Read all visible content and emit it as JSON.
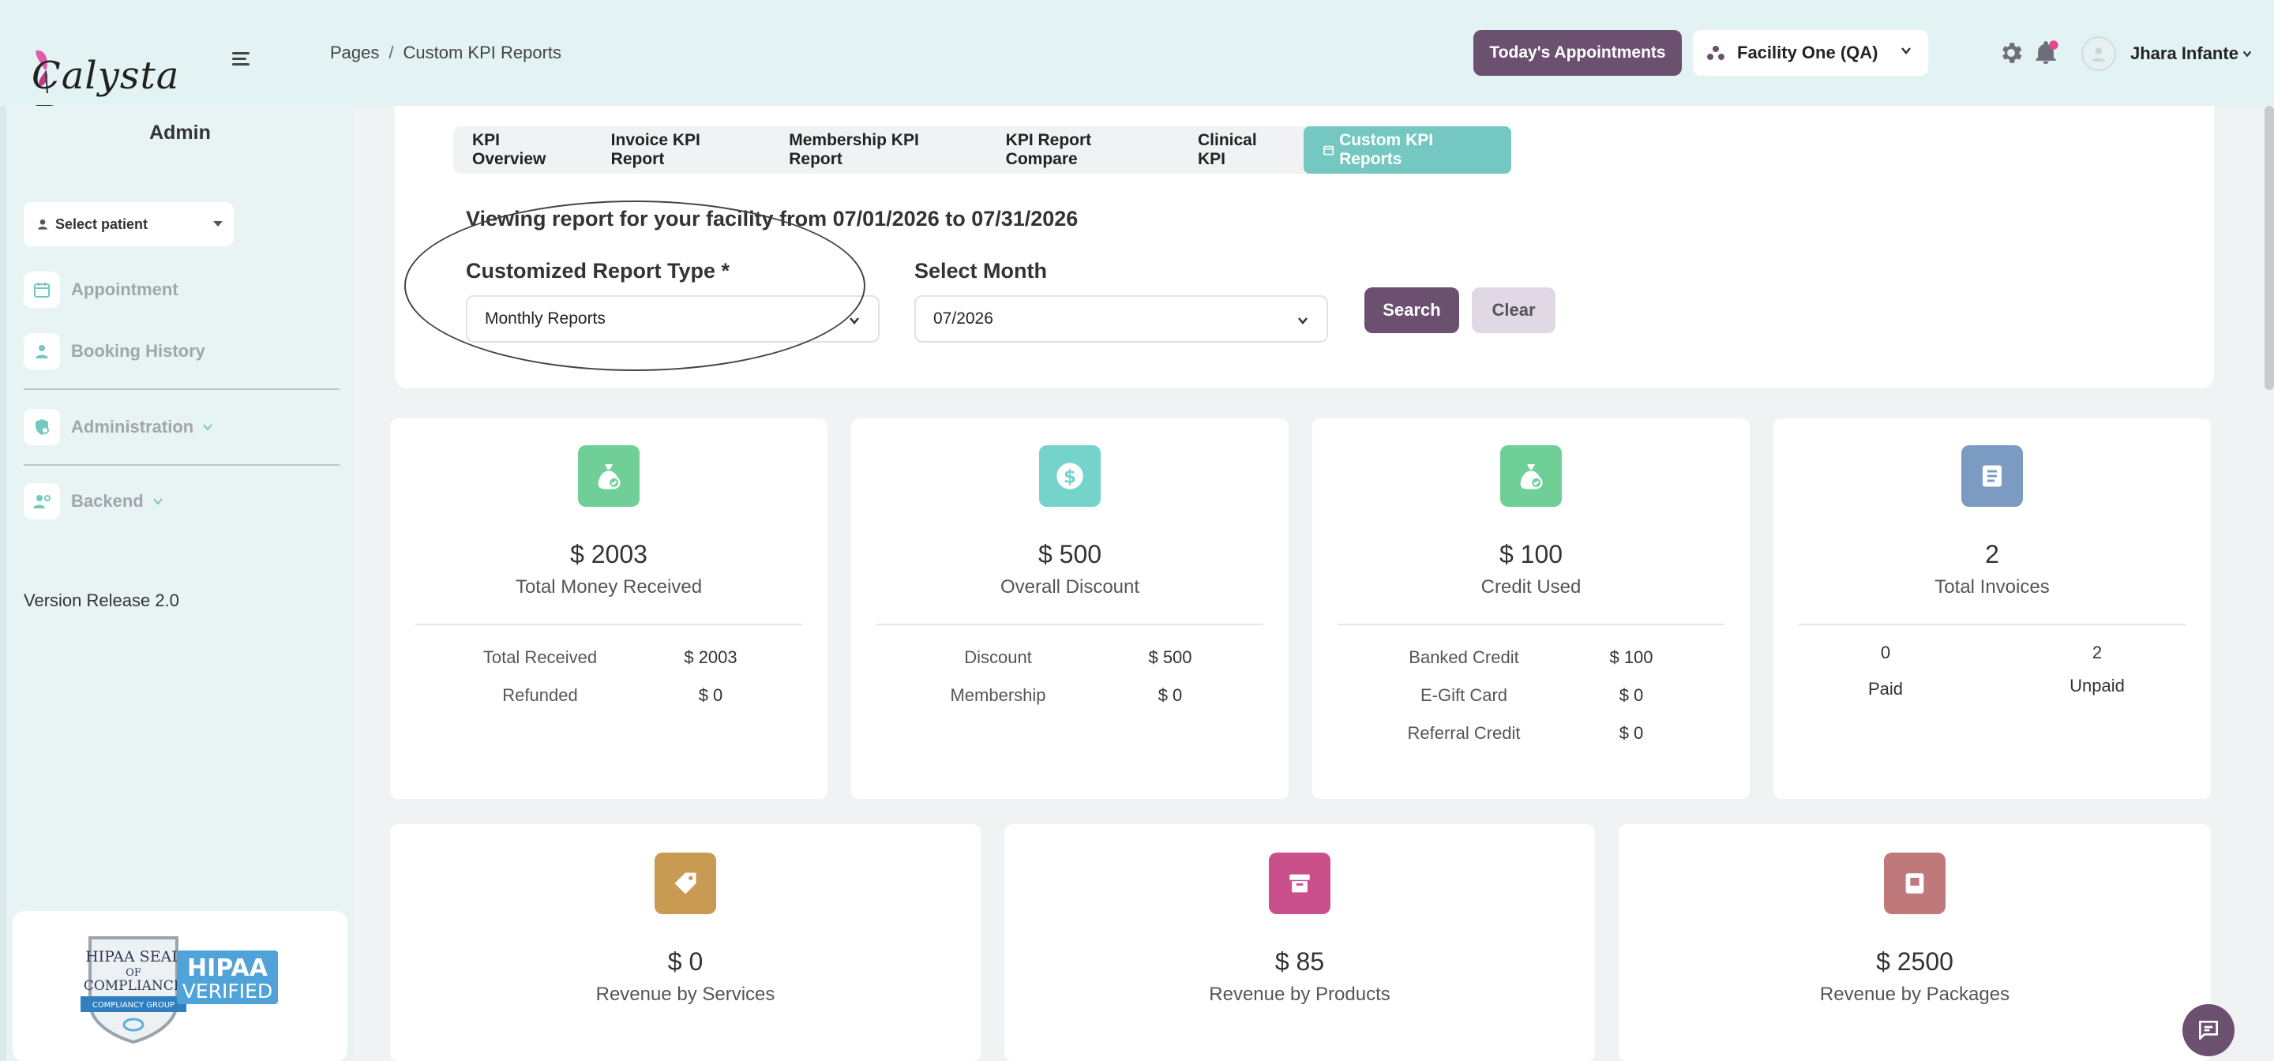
{
  "header": {
    "logo_text": "Calysta Pro",
    "breadcrumb": {
      "root": "Pages",
      "sep": "/",
      "current": "Custom KPI Reports"
    },
    "appointments_button": "Today's Appointments",
    "facility": "Facility One (QA)",
    "user_name": "Jhara Infante"
  },
  "sidebar": {
    "title": "Admin",
    "select_patient": "Select patient",
    "items": [
      {
        "label": "Appointment",
        "icon": "calendar-icon"
      },
      {
        "label": "Booking History",
        "icon": "person-icon"
      },
      {
        "label": "Administration",
        "icon": "shield-icon"
      },
      {
        "label": "Backend",
        "icon": "user-cog-icon"
      }
    ],
    "version": "Version Release 2.0",
    "hipaa": {
      "line1": "HIPAA SEAL",
      "line2": "OF",
      "line3": "COMPLIANCE",
      "ribbon": "COMPLIANCY GROUP",
      "badge_top": "HIPAA",
      "badge_bottom": "VERIFIED"
    }
  },
  "tabs": [
    {
      "label": "KPI Overview",
      "active": false
    },
    {
      "label": "Invoice KPI Report",
      "active": false
    },
    {
      "label": "Membership KPI Report",
      "active": false
    },
    {
      "label": "KPI Report Compare",
      "active": false
    },
    {
      "label": "Clinical KPI",
      "active": false
    },
    {
      "label": "Custom KPI Reports",
      "active": true
    }
  ],
  "filters": {
    "viewing_text": "Viewing report for your facility from 07/01/2026 to 07/31/2026",
    "report_type_label": "Customized Report Type *",
    "report_type_value": "Monthly Reports",
    "month_label": "Select Month",
    "month_value": "07/2026",
    "search_label": "Search",
    "clear_label": "Clear"
  },
  "kpi_cards": [
    {
      "value": "$ 2003",
      "label": "Total Money Received",
      "color": "#6fcf97",
      "rows": [
        {
          "label": "Total Received",
          "value": "$ 2003"
        },
        {
          "label": "Refunded",
          "value": "$ 0"
        }
      ]
    },
    {
      "value": "$ 500",
      "label": "Overall Discount",
      "color": "#74d4cc",
      "rows": [
        {
          "label": "Discount",
          "value": "$ 500"
        },
        {
          "label": "Membership",
          "value": "$ 0"
        }
      ]
    },
    {
      "value": "$ 100",
      "label": "Credit Used",
      "color": "#6fcf97",
      "rows": [
        {
          "label": "Banked Credit",
          "value": "$ 100"
        },
        {
          "label": "E-Gift Card",
          "value": "$ 0"
        },
        {
          "label": "Referral Credit",
          "value": "$ 0"
        }
      ]
    },
    {
      "value": "2",
      "label": "Total Invoices",
      "color": "#7b9bc2",
      "paid_count": "0",
      "paid_label": "Paid",
      "unpaid_count": "2",
      "unpaid_label": "Unpaid"
    }
  ],
  "revenue_cards": [
    {
      "value": "$ 0",
      "label": "Revenue by Services",
      "color": "#c99a52"
    },
    {
      "value": "$ 85",
      "label": "Revenue by Products",
      "color": "#c9508a"
    },
    {
      "value": "$ 2500",
      "label": "Revenue by Packages",
      "color": "#c0797b"
    }
  ]
}
